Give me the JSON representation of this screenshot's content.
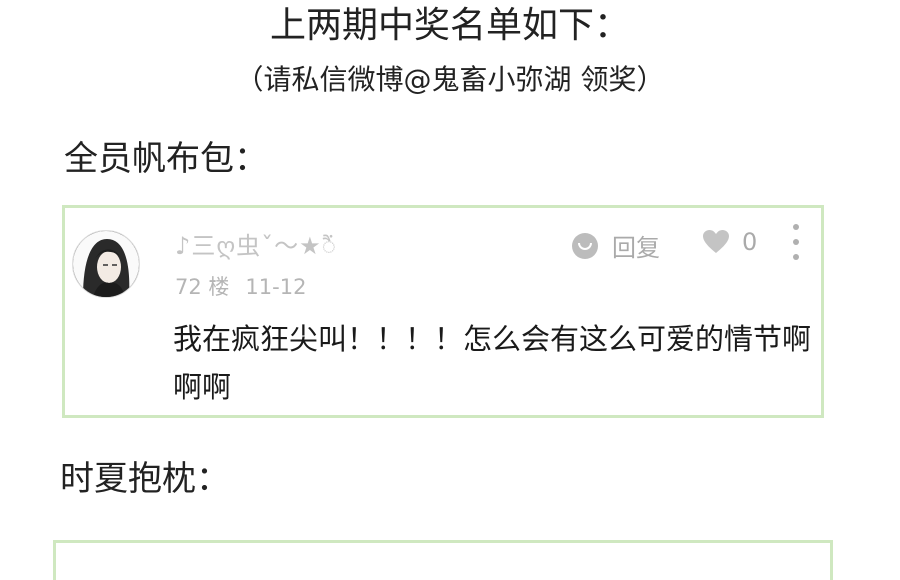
{
  "header": {
    "title": "上两期中奖名单如下：",
    "subtitle": "（请私信微博@鬼畜小弥湖 领奖）"
  },
  "sections": [
    {
      "heading": "全员帆布包：",
      "comment": {
        "username": "♪三ღ虫ˇ〜★ैं",
        "floor": "72 楼",
        "date": "11-12",
        "reply_label": "回复",
        "like_count": "0",
        "text": "我在疯狂尖叫！！！！怎么会有这么可爱的情节啊啊啊"
      }
    },
    {
      "heading": "时夏抱枕："
    }
  ],
  "colors": {
    "card_border": "#cfe8c0",
    "muted_text": "#b5b5b5",
    "icon_gray": "#bcbcbc"
  },
  "icons": {
    "reply": "reply-icon",
    "like": "heart-icon",
    "more": "more-vertical-icon"
  }
}
